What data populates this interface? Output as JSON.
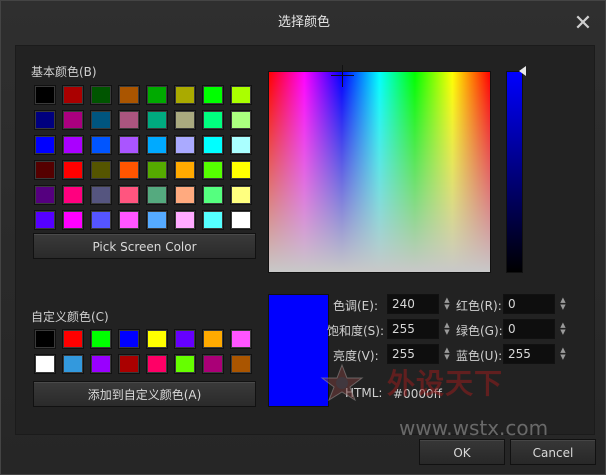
{
  "dialog": {
    "title": "选择颜色",
    "close": "✕"
  },
  "basic_colors": {
    "label": "基本颜色(B)",
    "swatches": [
      "#000000",
      "#aa0000",
      "#005500",
      "#aa5500",
      "#00aa00",
      "#aaaa00",
      "#00ff00",
      "#aaff00",
      "#00007f",
      "#aa007f",
      "#00557f",
      "#aa557f",
      "#00aa7f",
      "#aaaa7f",
      "#00ff7f",
      "#aaff7f",
      "#0000ff",
      "#aa00ff",
      "#0055ff",
      "#aa55ff",
      "#00aaff",
      "#aaaaff",
      "#00ffff",
      "#aaffff",
      "#550000",
      "#ff0000",
      "#555500",
      "#ff5500",
      "#55aa00",
      "#ffaa00",
      "#55ff00",
      "#ffff00",
      "#55007f",
      "#ff007f",
      "#55557f",
      "#ff557f",
      "#55aa7f",
      "#ffaa7f",
      "#55ff7f",
      "#ffff7f",
      "#5500ff",
      "#ff00ff",
      "#5555ff",
      "#ff55ff",
      "#55aaff",
      "#ffaaff",
      "#55ffff",
      "#ffffff"
    ]
  },
  "pick_screen_button": "Pick Screen Color",
  "custom_colors": {
    "label": "自定义颜色(C)",
    "swatches": [
      "#000000",
      "#ff0000",
      "#00ff00",
      "#0000ff",
      "#ffff00",
      "#6600ff",
      "#ffaa00",
      "#ff55ff",
      "#ffffff",
      "#3399dd",
      "#9900ff",
      "#aa0000",
      "#ff0066",
      "#66ff00",
      "#aa0077",
      "#aa5500"
    ]
  },
  "add_custom_button": "添加到自定义颜色(A)",
  "fields": {
    "hue": {
      "label": "色调(E):",
      "value": "240"
    },
    "sat": {
      "label": "饱和度(S):",
      "value": "255"
    },
    "val": {
      "label": "亮度(V):",
      "value": "255"
    },
    "red": {
      "label": "红色(R):",
      "value": "0"
    },
    "green": {
      "label": "绿色(G):",
      "value": "0"
    },
    "blue": {
      "label": "蓝色(U):",
      "value": "255"
    },
    "html": {
      "label": "HTML:",
      "value": "#0000ff"
    }
  },
  "current_color": "#0000ff",
  "watermark": {
    "text": "外设天下",
    "url": "www.wstx.com"
  },
  "buttons": {
    "ok": "OK",
    "cancel": "Cancel"
  },
  "icons": {
    "close": "close-icon",
    "spin": "spin-arrows-icon"
  }
}
